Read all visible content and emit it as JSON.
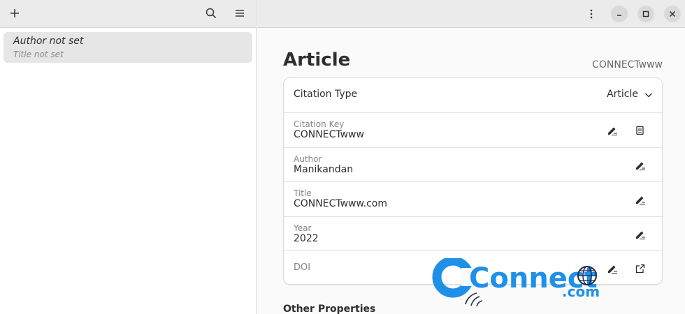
{
  "sidebar": {
    "header": {
      "add_icon": "plus-icon",
      "search_icon": "search-icon",
      "menu_icon": "hamburger-menu-icon"
    },
    "entries": [
      {
        "author": "Author not set",
        "title": "Title not set"
      }
    ]
  },
  "header": {
    "kebab_icon": "vertical-dots-icon",
    "minimize_icon": "minimize-icon",
    "maximize_icon": "maximize-icon",
    "close_icon": "close-icon"
  },
  "main": {
    "title": "Article",
    "citation_key_display": "CONNECTwww",
    "citation_type": {
      "label": "Citation Type",
      "value": "Article"
    },
    "fields": [
      {
        "label": "Citation Key",
        "value": "CONNECTwww"
      },
      {
        "label": "Author",
        "value": "Manikandan"
      },
      {
        "label": "Title",
        "value": "CONNECTwww.com"
      },
      {
        "label": "Year",
        "value": "2022"
      },
      {
        "label": "DOI",
        "value": ""
      }
    ],
    "other_properties_title": "Other Properties"
  },
  "watermark": {
    "brand": "Connect",
    "suffix": ".com"
  }
}
